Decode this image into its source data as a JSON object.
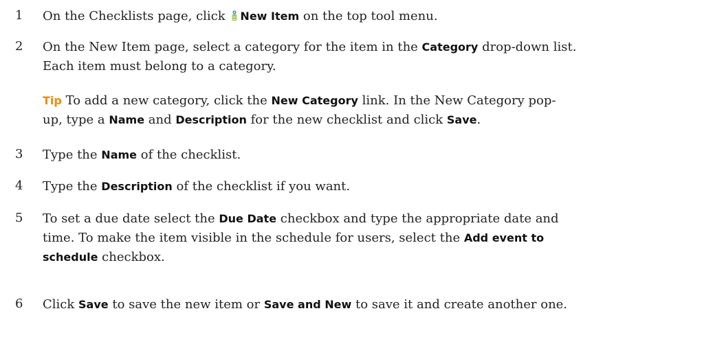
{
  "steps": [
    {
      "num": "1",
      "a": "On the Checklists page, click",
      "b1": "New Item",
      "c": "on the top tool menu."
    },
    {
      "num": "2",
      "a": "On the New Item page, select a category for the item in the",
      "b1": "Category",
      "c": "drop-down list.",
      "d": "Each item must belong to a category.",
      "tip": {
        "label": "Tip",
        "a": "To add a new category, click the",
        "b1": "New Category",
        "c": "link. In the New Category pop-",
        "d": "up, type a",
        "b2": "Name",
        "e": "and",
        "b3": "Description",
        "f": "for the new checklist and click",
        "b4": "Save",
        "g": "."
      }
    },
    {
      "num": "3",
      "a": "Type the",
      "b1": "Name",
      "c": "of the checklist."
    },
    {
      "num": "4",
      "a": "Type the",
      "b1": "Description",
      "c": "of the checklist if you want."
    },
    {
      "num": "5",
      "a": "To set a due date select the",
      "b1": "Due Date",
      "c": "checkbox and type the appropriate date and",
      "d": "time. To make the item visible in the schedule for users, select the",
      "b2": "Add event to",
      "b3": "schedule",
      "e": "checkbox."
    },
    {
      "num": "6",
      "a": "Click",
      "b1": "Save",
      "c": "to save the new item or",
      "b2": "Save and New",
      "d": "to save it and create another one."
    }
  ],
  "icons": {
    "new_item": "new-item-icon"
  },
  "colors": {
    "text": "#222222",
    "tip": "#f08a00",
    "icon_blue": "#3a8fd8",
    "icon_green": "#8bbf3a"
  }
}
